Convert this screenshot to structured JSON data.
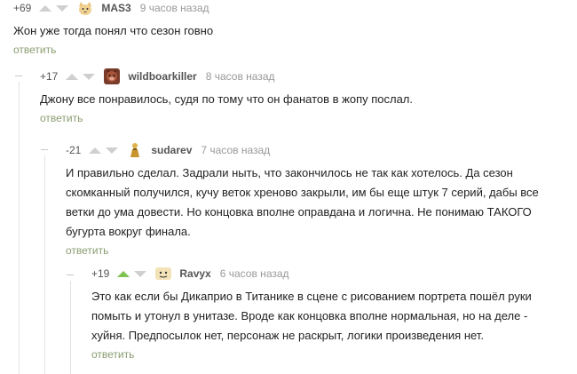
{
  "reply_label": "ответить",
  "comments": [
    {
      "rating": "+69",
      "author": "MAS3",
      "time": "9 часов назад",
      "avatar_icon": "cat-face-icon",
      "text": "Жон уже тогда понял что сезон говно"
    },
    {
      "rating": "+17",
      "author": "wildboarkiller",
      "time": "8 часов назад",
      "avatar_icon": "boar-face-icon",
      "text": "Джону все понравилось, судя по тому что он фанатов в жопу послал."
    },
    {
      "rating": "-21",
      "author": "sudarev",
      "time": "7 часов назад",
      "avatar_icon": "figure-icon",
      "text_lines": [
        "И правильно сделал. Задрали ныть, что закончилось не так как хотелось. Да сезон",
        "скомканный получился, кучу веток хреново закрыли, им бы еще штук 7 серий, дабы все",
        "ветки до ума довести. Но концовка вполне оправдана и логична. Не понимаю ТАКОГО",
        "бугурта вокруг финала."
      ]
    },
    {
      "rating": "+19",
      "author": "Ravyx",
      "time": "6 часов назад",
      "avatar_icon": "face-icon",
      "upvoted": true,
      "text_lines": [
        "Это как если бы Дикаприо в Титанике в сцене с рисованием портрета пошёл руки",
        "помыть и утонул в унитазе. Вроде как концовка вполне нормальная, но на деле -",
        "хуйня. Предпосылок нет, персонаж не раскрыт, логики произведения нет."
      ]
    }
  ],
  "colors": {
    "arrow_inactive": "#cfcfcf",
    "arrow_active": "#7fc24f",
    "reply_link": "#8a9d70",
    "rail": "#e3e3e3"
  }
}
